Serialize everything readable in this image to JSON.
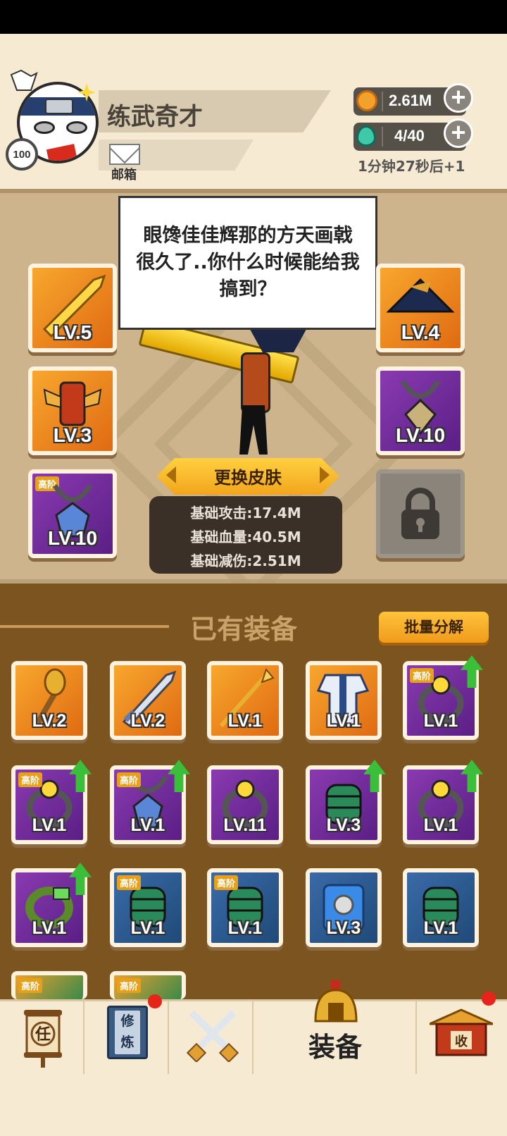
{
  "header": {
    "player_name": "练武奇才",
    "level": "100",
    "mail_label": "邮箱",
    "coins": "2.61M",
    "stamina": "4/40",
    "stamina_timer": "1分钟27秒后+1",
    "plus_symbol": "+"
  },
  "dialogue": "眼馋佳佳辉那的方天画戟很久了..你什么时候能给我搞到？",
  "equipped": {
    "weapon": {
      "level": "LV.5",
      "rarity": "orange"
    },
    "armor": {
      "level": "LV.3",
      "rarity": "orange"
    },
    "amulet": {
      "level": "LV.10",
      "rarity": "purple",
      "tier": "高阶"
    },
    "hat": {
      "level": "LV.4",
      "rarity": "orange"
    },
    "necklace": {
      "level": "LV.10",
      "rarity": "purple"
    },
    "locked_slot": {
      "icon": "lock-icon"
    }
  },
  "skin_button": "更换皮肤",
  "stats": {
    "attack": "基础攻击:17.4M",
    "hp": "基础血量:40.5M",
    "reduction": "基础减伤:2.51M"
  },
  "inventory": {
    "title": "已有装备",
    "batch_button": "批量分解",
    "items": [
      {
        "level": "LV.2",
        "rarity": "orange",
        "tier": "",
        "upgrade": false,
        "icon": "mace-icon"
      },
      {
        "level": "LV.2",
        "rarity": "orange",
        "tier": "",
        "upgrade": false,
        "icon": "sword-icon"
      },
      {
        "level": "LV.1",
        "rarity": "orange",
        "tier": "",
        "upgrade": false,
        "icon": "spear-icon"
      },
      {
        "level": "LV.1",
        "rarity": "orange",
        "tier": "",
        "upgrade": false,
        "icon": "robe-icon"
      },
      {
        "level": "LV.1",
        "rarity": "purple",
        "tier": "高阶",
        "upgrade": true,
        "icon": "ring-icon"
      },
      {
        "level": "LV.1",
        "rarity": "purple",
        "tier": "高阶",
        "upgrade": true,
        "icon": "ring-icon"
      },
      {
        "level": "LV.1",
        "rarity": "purple",
        "tier": "高阶",
        "upgrade": true,
        "icon": "necklace-icon"
      },
      {
        "level": "LV.11",
        "rarity": "purple",
        "tier": "",
        "upgrade": false,
        "icon": "ring-icon"
      },
      {
        "level": "LV.3",
        "rarity": "purple",
        "tier": "",
        "upgrade": true,
        "icon": "bracer-icon"
      },
      {
        "level": "LV.1",
        "rarity": "purple",
        "tier": "",
        "upgrade": true,
        "icon": "ring-icon"
      },
      {
        "level": "LV.1",
        "rarity": "purple",
        "tier": "",
        "upgrade": true,
        "icon": "bracelet-icon"
      },
      {
        "level": "LV.1",
        "rarity": "blue",
        "tier": "高阶",
        "upgrade": false,
        "icon": "bracer-icon"
      },
      {
        "level": "LV.1",
        "rarity": "blue",
        "tier": "高阶",
        "upgrade": false,
        "icon": "bracer-icon"
      },
      {
        "level": "LV.3",
        "rarity": "blue",
        "tier": "",
        "upgrade": false,
        "icon": "vest-icon"
      },
      {
        "level": "LV.1",
        "rarity": "blue",
        "tier": "",
        "upgrade": false,
        "icon": "bracer-icon"
      }
    ],
    "partial_row": [
      {
        "tier": "高阶"
      },
      {
        "tier": "高阶"
      }
    ]
  },
  "nav": {
    "task_glyph": "任",
    "cultivate_glyph_1": "修",
    "cultivate_glyph_2": "炼",
    "equip_label": "装备",
    "collect_glyph": "收"
  },
  "colors": {
    "orange": "#f08a22",
    "purple": "#6e2a9c",
    "blue": "#2a5a92",
    "upgrade_arrow": "#3bbf3a",
    "notify_dot": "#e8241a"
  }
}
